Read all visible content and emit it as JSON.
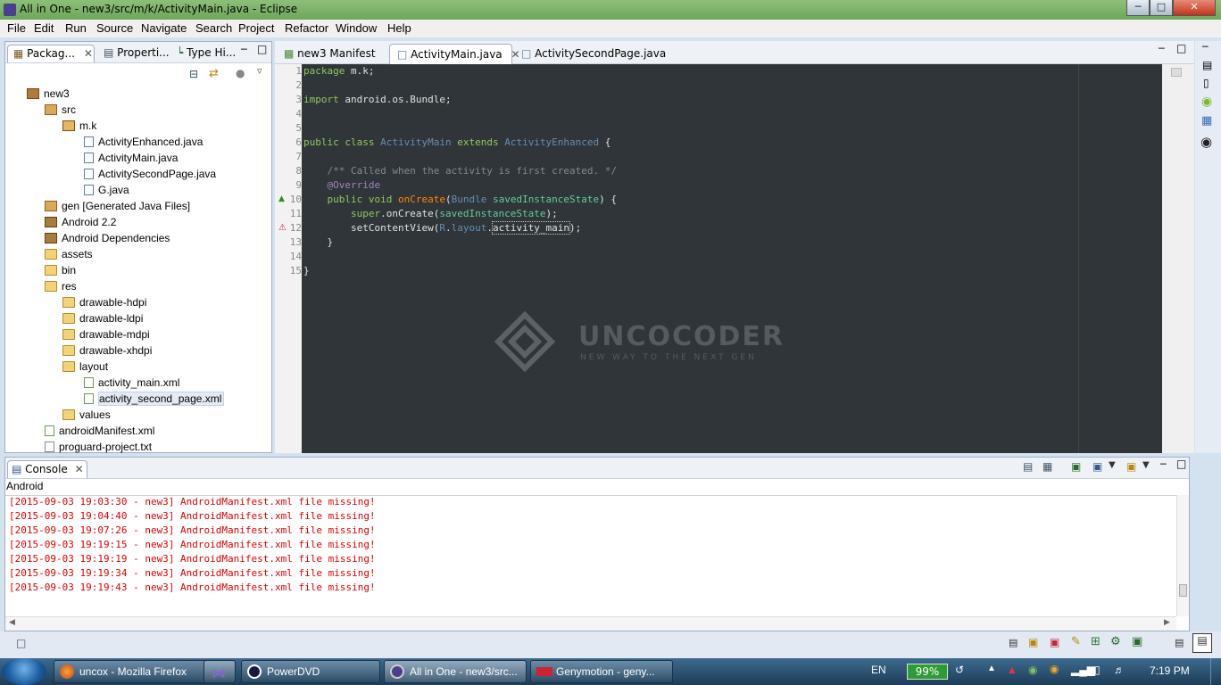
{
  "window": {
    "title": "All in One - new3/src/m/k/ActivityMain.java - Eclipse"
  },
  "menu": [
    "File",
    "Edit",
    "Run",
    "Source",
    "Navigate",
    "Search",
    "Project",
    "Refactor",
    "Window",
    "Help"
  ],
  "left_tabs": [
    "Packag...",
    "Properti...",
    "Type Hi..."
  ],
  "tree": [
    {
      "label": "new3",
      "indent": 0,
      "icon": "project-icon"
    },
    {
      "label": "src",
      "indent": 1,
      "icon": "source-folder-icon"
    },
    {
      "label": "m.k",
      "indent": 2,
      "icon": "package-icon"
    },
    {
      "label": "ActivityEnhanced.java",
      "indent": 3,
      "icon": "java-file-icon"
    },
    {
      "label": "ActivityMain.java",
      "indent": 3,
      "icon": "java-file-icon"
    },
    {
      "label": "ActivitySecondPage.java",
      "indent": 3,
      "icon": "java-file-icon"
    },
    {
      "label": "G.java",
      "indent": 3,
      "icon": "java-file-icon"
    },
    {
      "label": "gen [Generated Java Files]",
      "indent": 1,
      "icon": "source-folder-icon"
    },
    {
      "label": "Android 2.2",
      "indent": 1,
      "icon": "library-icon"
    },
    {
      "label": "Android Dependencies",
      "indent": 1,
      "icon": "library-icon"
    },
    {
      "label": "assets",
      "indent": 1,
      "icon": "folder-icon"
    },
    {
      "label": "bin",
      "indent": 1,
      "icon": "folder-icon"
    },
    {
      "label": "res",
      "indent": 1,
      "icon": "folder-icon"
    },
    {
      "label": "drawable-hdpi",
      "indent": 2,
      "icon": "folder-icon"
    },
    {
      "label": "drawable-ldpi",
      "indent": 2,
      "icon": "folder-icon"
    },
    {
      "label": "drawable-mdpi",
      "indent": 2,
      "icon": "folder-icon"
    },
    {
      "label": "drawable-xhdpi",
      "indent": 2,
      "icon": "folder-icon"
    },
    {
      "label": "layout",
      "indent": 2,
      "icon": "folder-icon"
    },
    {
      "label": "activity_main.xml",
      "indent": 3,
      "icon": "xml-file-icon"
    },
    {
      "label": "activity_second_page.xml",
      "indent": 3,
      "icon": "xml-file-icon",
      "selected": true
    },
    {
      "label": "values",
      "indent": 2,
      "icon": "folder-icon"
    },
    {
      "label": "androidManifest.xml",
      "indent": 1,
      "icon": "xml-file-icon"
    },
    {
      "label": "proguard-project.txt",
      "indent": 1,
      "icon": "text-file-icon"
    }
  ],
  "editor_tabs": [
    {
      "label": "new3 Manifest",
      "active": false
    },
    {
      "label": "ActivityMain.java",
      "active": true
    },
    {
      "label": "ActivitySecondPage.java",
      "active": false
    }
  ],
  "line_numbers": [
    "1",
    "2",
    "3",
    "4",
    "5",
    "6",
    "7",
    "8",
    "9",
    "10",
    "11",
    "12",
    "13",
    "14",
    "15"
  ],
  "code": {
    "l1_kw": "package",
    "l1_rest": " m.k;",
    "l3_kw": "import",
    "l3_rest": " android.os.Bundle;",
    "l6_kw": "public class",
    "l6_cls": "ActivityMain",
    "l6_kw2": "extends",
    "l6_cls2": "ActivityEnhanced",
    "l6_rest": " {",
    "l8_cmt": "    /** Called when the activity is first created. */",
    "l9_ann": "    @Override",
    "l10_kw": "    public void",
    "l10_m": "onCreate",
    "l10_p1": "(",
    "l10_cls": "Bundle",
    "l10_var": "savedInstanceState",
    "l10_rest": ") {",
    "l11_kw": "        super",
    "l11_m": ".onCreate(",
    "l11_var": "savedInstanceState",
    "l11_rest": ");",
    "l12_m": "        setContentView(",
    "l12_r": "R",
    "l12_dot": ".",
    "l12_layout": "layout",
    "l12_dot2": ".",
    "l12_field": "activity_main",
    "l12_rest": ");",
    "l13": "    }",
    "l15": "}"
  },
  "watermark": {
    "brand": "UNCOCODER",
    "tagline": "NEW WAY TO THE NEXT GEN"
  },
  "console": {
    "tab": "Console",
    "label": "Android",
    "lines": [
      "[2015-09-03 19:03:30 - new3] AndroidManifest.xml file missing!",
      "[2015-09-03 19:04:40 - new3] AndroidManifest.xml file missing!",
      "[2015-09-03 19:07:26 - new3] AndroidManifest.xml file missing!",
      "[2015-09-03 19:19:15 - new3] AndroidManifest.xml file missing!",
      "[2015-09-03 19:19:19 - new3] AndroidManifest.xml file missing!",
      "[2015-09-03 19:19:34 - new3] AndroidManifest.xml file missing!",
      "[2015-09-03 19:19:43 - new3] AndroidManifest.xml file missing!"
    ]
  },
  "taskbar": {
    "tasks": [
      {
        "label": "uncox - Mozilla Firefox",
        "active": false
      },
      {
        "label": "",
        "active": false
      },
      {
        "label": "PowerDVD",
        "active": false
      },
      {
        "label": "All in One - new3/src...",
        "active": true
      },
      {
        "label": "Genymotion - geny...",
        "active": false
      }
    ],
    "lang": "EN",
    "battery": "99%",
    "time": "7:19 PM"
  }
}
